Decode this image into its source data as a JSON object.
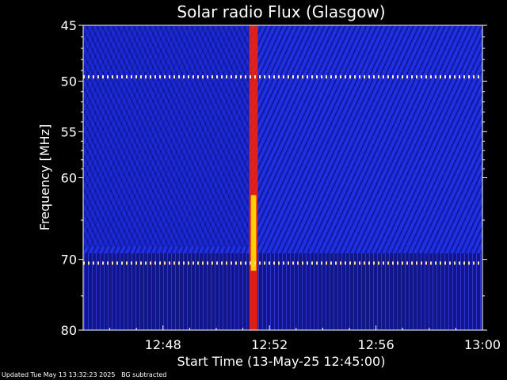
{
  "chart_data": {
    "type": "heatmap",
    "title": "Solar radio Flux (Glasgow)",
    "xlabel": "Start Time (13-May-25 12:45:00)",
    "ylabel": "Frequency [MHz]",
    "x_range_minutes": [
      0,
      15
    ],
    "x_ticks": [
      {
        "label": "12:48",
        "minute": 3
      },
      {
        "label": "12:52",
        "minute": 7
      },
      {
        "label": "12:56",
        "minute": 11
      },
      {
        "label": "13:00",
        "minute": 15
      }
    ],
    "y_scale": "log",
    "y_range_mhz": [
      45,
      80
    ],
    "y_ticks": [
      {
        "label": "45",
        "value": 45
      },
      {
        "label": "50",
        "value": 50
      },
      {
        "label": "55",
        "value": 55
      },
      {
        "label": "60",
        "value": 60
      },
      {
        "label": "70",
        "value": 70
      },
      {
        "label": "80",
        "value": 80
      }
    ],
    "background_color": "#1a1fc8",
    "features": [
      {
        "name": "burst",
        "start_minute": 6.3,
        "end_minute": 6.5,
        "freq_range_mhz": [
          45,
          80
        ],
        "color": "#ffd000"
      },
      {
        "name": "interference band",
        "freq_mhz": 49.6,
        "color": "#fff0c0"
      },
      {
        "name": "interference band",
        "freq_mhz": 70.5,
        "color": "#ffe0a0"
      }
    ],
    "colors": {
      "low": "#101080",
      "mid": "#3040ff",
      "high": "#ff2000",
      "max": "#ffffff"
    }
  },
  "footer": {
    "updated": "Updated Tue May 13 13:32:23 2025",
    "note": "BG subtracted"
  }
}
